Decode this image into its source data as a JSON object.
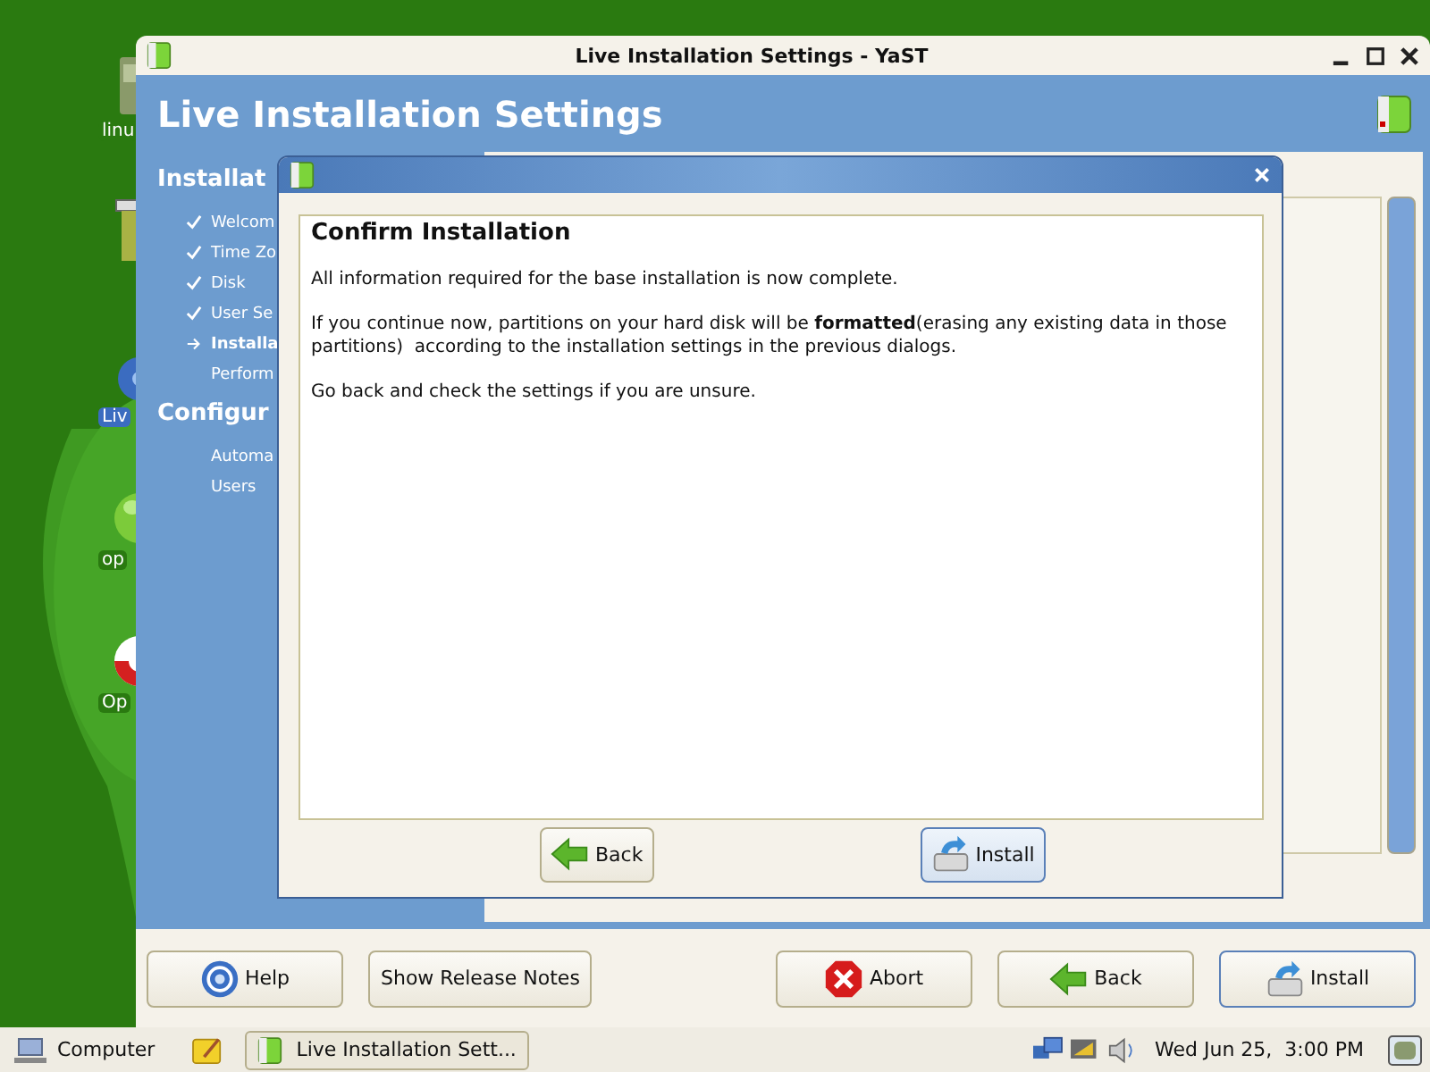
{
  "desktop": {
    "icons": [
      {
        "kind": "drive",
        "label": "linu",
        "selected": false
      },
      {
        "kind": "disc",
        "label": "Liv",
        "selected": true
      },
      {
        "kind": "ball",
        "label": "op",
        "selected": false
      },
      {
        "kind": "lifebuoy",
        "label": "Op",
        "selected": false
      }
    ]
  },
  "window": {
    "title": "Live Installation Settings - YaST",
    "heading": "Live Installation Settings"
  },
  "sidebar": {
    "sections": [
      {
        "title": "Installat",
        "steps": [
          {
            "label": "Welcom",
            "done": true,
            "selected": false
          },
          {
            "label": "Time Zo",
            "done": true,
            "selected": false
          },
          {
            "label": "Disk",
            "done": true,
            "selected": false
          },
          {
            "label": "User Se",
            "done": true,
            "selected": false
          },
          {
            "label": "Installa",
            "done": false,
            "selected": true
          },
          {
            "label": "Perform",
            "done": false,
            "selected": false
          }
        ]
      },
      {
        "title": "Configur",
        "steps": [
          {
            "label": "Automa",
            "done": false,
            "selected": false
          },
          {
            "label": "Users",
            "done": false,
            "selected": false
          }
        ]
      }
    ]
  },
  "footer": {
    "left": [
      {
        "label": "Help",
        "kind": "help",
        "default": false
      },
      {
        "label": "Show Release Notes",
        "kind": "plain",
        "default": false
      }
    ],
    "right": [
      {
        "label": "Abort",
        "kind": "abort",
        "default": false
      },
      {
        "label": "Back",
        "kind": "back",
        "default": false
      },
      {
        "label": "Install",
        "kind": "install",
        "default": true
      }
    ]
  },
  "dialog": {
    "heading": "Confirm Installation",
    "paragraphs": [
      "All information required for the base installation is now complete.",
      "If you continue now, partitions on your hard disk will be **formatted**(erasing any existing data in those partitions)  according to the installation settings in the previous dialogs.",
      "Go back and check the settings if you are unsure."
    ],
    "buttons": [
      {
        "label": "Back",
        "kind": "back",
        "focused": false
      },
      {
        "label": "Install",
        "kind": "install",
        "focused": true
      }
    ]
  },
  "taskbar": {
    "launcher": "Computer",
    "tasks": [
      {
        "label": "Live Installation Sett...",
        "selected": false
      }
    ],
    "clock": "Wed Jun 25,  3:00 PM"
  }
}
